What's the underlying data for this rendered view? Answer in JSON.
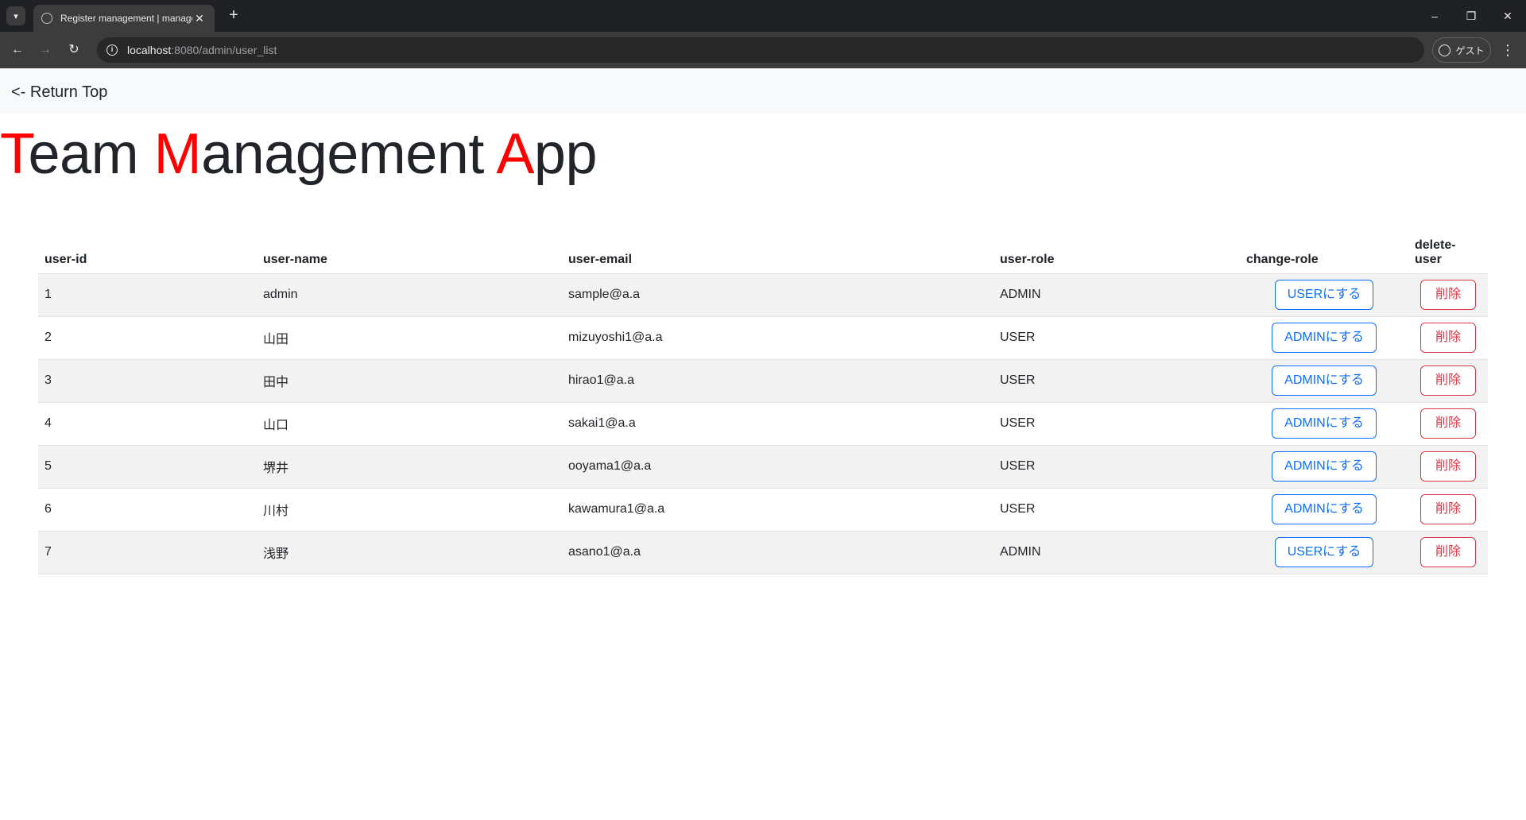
{
  "browser": {
    "tab_title": "Register management | manage",
    "tab_close": "✕",
    "new_tab": "+",
    "url_host": "localhost",
    "url_path": ":8080/admin/user_list",
    "profile_label": "ゲスト",
    "minimize": "–",
    "restore": "❐",
    "close": "✕"
  },
  "nav": {
    "return_label": "<- Return Top"
  },
  "title": {
    "part1_accent": "T",
    "part1_rest": "eam ",
    "part2_accent": "M",
    "part2_rest": "anagement ",
    "part3_accent": "A",
    "part3_rest": "pp"
  },
  "table": {
    "headers": {
      "id": "user-id",
      "name": "user-name",
      "email": "user-email",
      "role": "user-role",
      "change": "change-role",
      "delete": "delete-user"
    },
    "rows": [
      {
        "id": "1",
        "name": "admin",
        "email": "sample@a.a",
        "role": "ADMIN",
        "change": "USERにする",
        "delete": "削除"
      },
      {
        "id": "2",
        "name": "山田",
        "email": "mizuyoshi1@a.a",
        "role": "USER",
        "change": "ADMINにする",
        "delete": "削除"
      },
      {
        "id": "3",
        "name": "田中",
        "email": "hirao1@a.a",
        "role": "USER",
        "change": "ADMINにする",
        "delete": "削除"
      },
      {
        "id": "4",
        "name": "山口",
        "email": "sakai1@a.a",
        "role": "USER",
        "change": "ADMINにする",
        "delete": "削除"
      },
      {
        "id": "5",
        "name": "堺井",
        "email": "ooyama1@a.a",
        "role": "USER",
        "change": "ADMINにする",
        "delete": "削除"
      },
      {
        "id": "6",
        "name": "川村",
        "email": "kawamura1@a.a",
        "role": "USER",
        "change": "ADMINにする",
        "delete": "削除"
      },
      {
        "id": "7",
        "name": "浅野",
        "email": "asano1@a.a",
        "role": "ADMIN",
        "change": "USERにする",
        "delete": "削除"
      }
    ]
  },
  "colors": {
    "accent_red": "#ff0000",
    "primary_blue": "#0d6efd",
    "danger_red": "#dc3545"
  }
}
